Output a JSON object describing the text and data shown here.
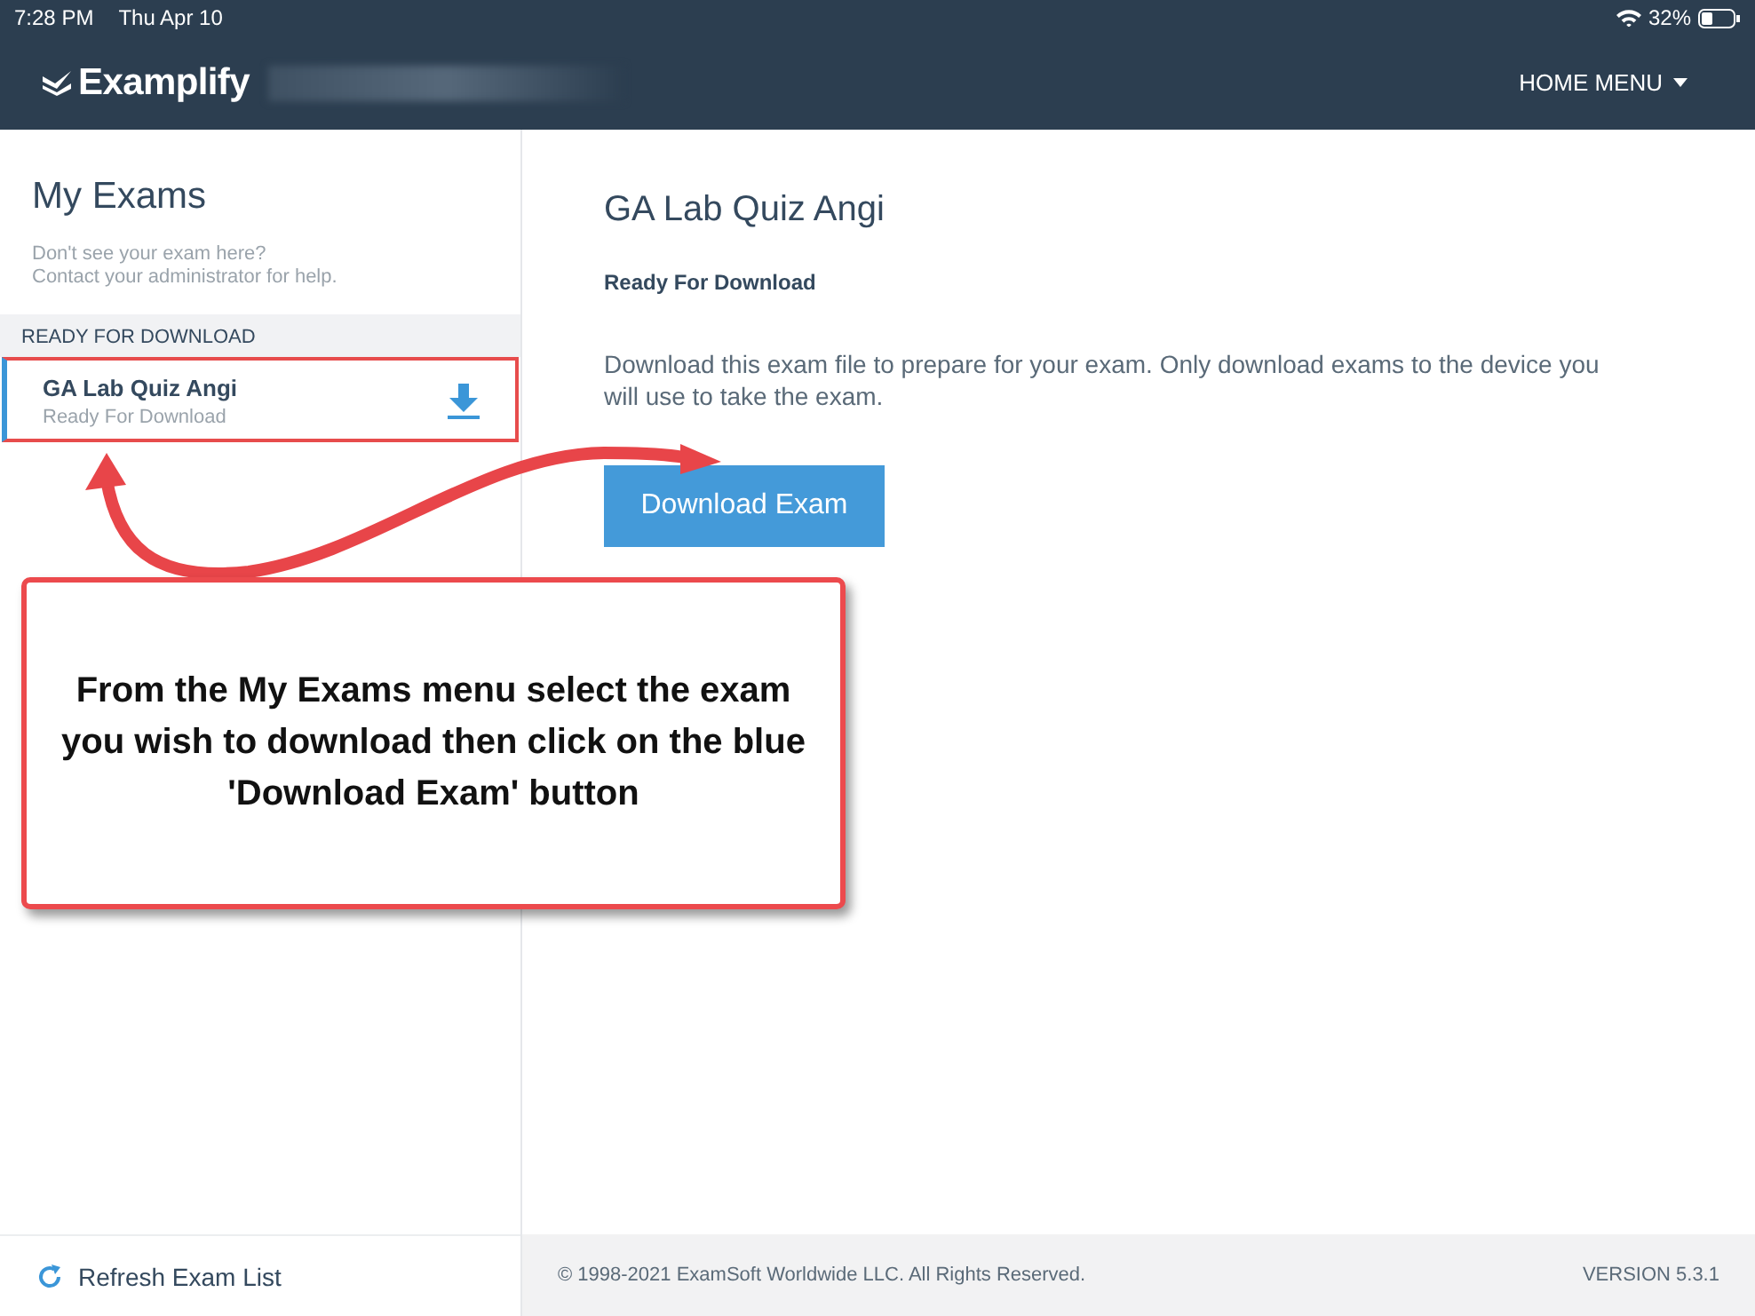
{
  "status_bar": {
    "time": "7:28 PM",
    "date": "Thu Apr 10",
    "battery": "32%"
  },
  "header": {
    "logo": "Examplify",
    "menu": "HOME MENU"
  },
  "sidebar": {
    "title": "My Exams",
    "hint": "Don't see your exam here?\nContact your administrator for help.",
    "section": "READY FOR DOWNLOAD",
    "items": [
      {
        "title": "GA Lab Quiz Angi",
        "status": "Ready For Download",
        "selected": true
      }
    ],
    "refresh": "Refresh Exam List"
  },
  "main": {
    "title": "GA Lab Quiz Angi",
    "status": "Ready For Download",
    "description": "Download this exam file to prepare for your exam. Only download exams to the device you will use to take the exam.",
    "button": "Download Exam"
  },
  "footer": {
    "copyright": "© 1998-2021 ExamSoft Worldwide LLC. All Rights Reserved.",
    "version": "VERSION 5.3.1"
  },
  "callout": {
    "text": "From the My Exams menu select the exam you wish to download then click on the blue 'Download Exam' button"
  }
}
